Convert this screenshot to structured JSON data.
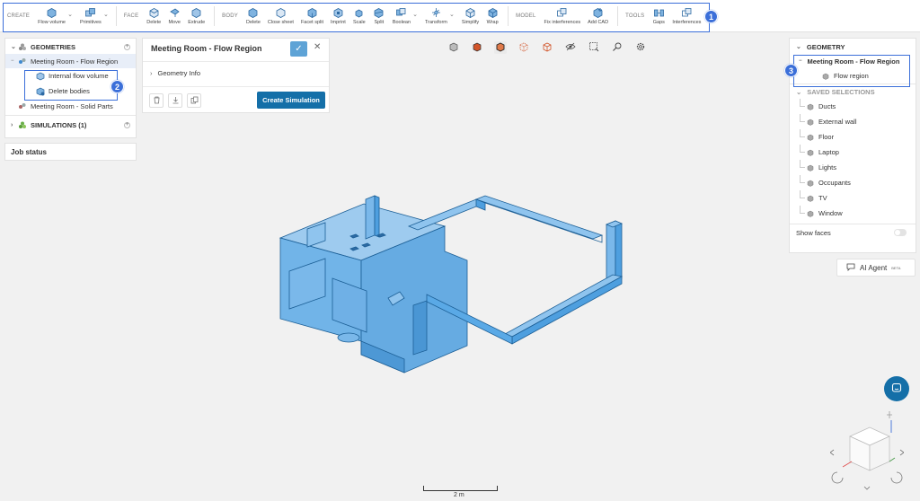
{
  "toolbar": {
    "groups": [
      {
        "label": "CREATE",
        "items": [
          {
            "label": "Flow volume",
            "icon": "flow-volume-icon",
            "dropdown": true
          },
          {
            "label": "Primitives",
            "icon": "primitives-icon",
            "dropdown": true
          }
        ]
      },
      {
        "label": "FACE",
        "items": [
          {
            "label": "Delete",
            "icon": "face-delete-icon"
          },
          {
            "label": "Move",
            "icon": "move-icon"
          },
          {
            "label": "Extrude",
            "icon": "extrude-icon"
          }
        ]
      },
      {
        "label": "BODY",
        "items": [
          {
            "label": "Delete",
            "icon": "body-delete-icon"
          },
          {
            "label": "Close sheet",
            "icon": "close-sheet-icon"
          },
          {
            "label": "Facet split",
            "icon": "facet-split-icon"
          },
          {
            "label": "Imprint",
            "icon": "imprint-icon"
          },
          {
            "label": "Scale",
            "icon": "scale-icon"
          },
          {
            "label": "Split",
            "icon": "split-icon"
          },
          {
            "label": "Boolean",
            "icon": "boolean-icon",
            "dropdown": true
          },
          {
            "label": "Transform",
            "icon": "transform-icon",
            "dropdown": true
          },
          {
            "label": "Simplify",
            "icon": "simplify-icon"
          },
          {
            "label": "Wrap",
            "icon": "wrap-icon"
          }
        ]
      },
      {
        "label": "MODEL",
        "items": [
          {
            "label": "Fix interferences",
            "icon": "fix-interferences-icon"
          },
          {
            "label": "Add CAD",
            "icon": "add-cad-icon"
          }
        ]
      },
      {
        "label": "TOOLS",
        "items": [
          {
            "label": "Gaps",
            "icon": "gaps-icon"
          },
          {
            "label": "Interferences",
            "icon": "interferences-icon"
          }
        ]
      }
    ]
  },
  "badges": {
    "one": "1",
    "two": "2",
    "three": "3"
  },
  "left_panel": {
    "geometries_header": "GEOMETRIES",
    "flow_region": "Meeting Room - Flow Region",
    "internal_flow_volume": "Internal flow volume",
    "delete_bodies": "Delete bodies",
    "solid_parts": "Meeting Room - Solid Parts",
    "simulations_header": "SIMULATIONS (1)"
  },
  "job_status": "Job status",
  "detail_panel": {
    "title": "Meeting Room - Flow Region",
    "geometry_info": "Geometry Info",
    "create_simulation": "Create Simulation"
  },
  "right_panel": {
    "geometry_header": "GEOMETRY",
    "flow_region_title": "Meeting Room - Flow Region",
    "flow_region_child": "Flow region",
    "saved_selections_header": "SAVED SELECTIONS",
    "saved_selections": [
      "Ducts",
      "External wall",
      "Floor",
      "Laptop",
      "Lights",
      "Occupants",
      "TV",
      "Window"
    ],
    "show_faces": "Show faces"
  },
  "ai_agent": {
    "label": "AI Agent",
    "beta": "BETA"
  },
  "scale_bar": "2 m",
  "colors": {
    "accent": "#146fa8",
    "highlight": "#3b6fd9",
    "model_fill": "#5aa9e6",
    "model_edge": "#1c5f96"
  }
}
